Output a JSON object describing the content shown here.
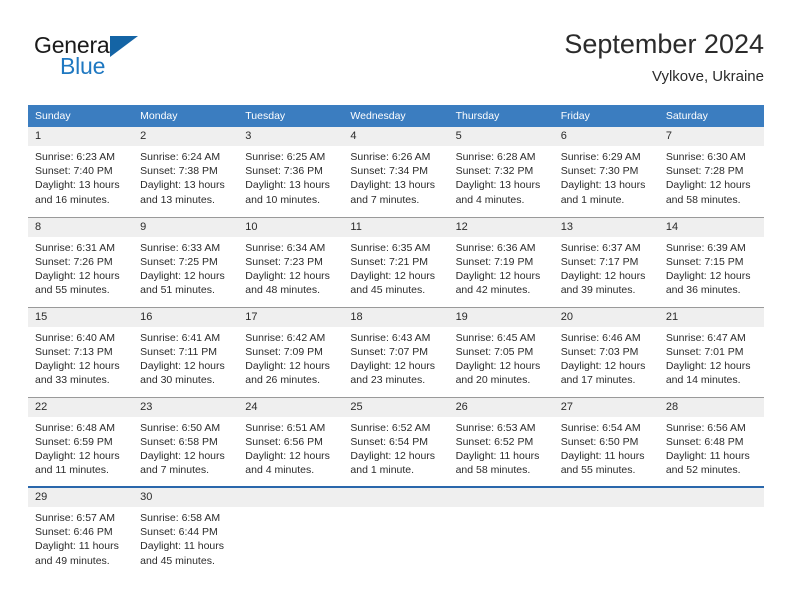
{
  "logo": {
    "word_top": "General",
    "word_bottom": "Blue",
    "accent_color": "#1464a5",
    "blue_text_color": "#1f78c1",
    "triangle_icon": "triangle-icon"
  },
  "header": {
    "title": "September 2024",
    "location": "Vylkove, Ukraine"
  },
  "calendar": {
    "header_bg": "#3b7dc0",
    "daynum_bg": "#efefef",
    "weekdays": [
      "Sunday",
      "Monday",
      "Tuesday",
      "Wednesday",
      "Thursday",
      "Friday",
      "Saturday"
    ],
    "weeks": [
      [
        {
          "day": "1",
          "sunrise": "Sunrise: 6:23 AM",
          "sunset": "Sunset: 7:40 PM",
          "daylight_1": "Daylight: 13 hours",
          "daylight_2": "and 16 minutes."
        },
        {
          "day": "2",
          "sunrise": "Sunrise: 6:24 AM",
          "sunset": "Sunset: 7:38 PM",
          "daylight_1": "Daylight: 13 hours",
          "daylight_2": "and 13 minutes."
        },
        {
          "day": "3",
          "sunrise": "Sunrise: 6:25 AM",
          "sunset": "Sunset: 7:36 PM",
          "daylight_1": "Daylight: 13 hours",
          "daylight_2": "and 10 minutes."
        },
        {
          "day": "4",
          "sunrise": "Sunrise: 6:26 AM",
          "sunset": "Sunset: 7:34 PM",
          "daylight_1": "Daylight: 13 hours",
          "daylight_2": "and 7 minutes."
        },
        {
          "day": "5",
          "sunrise": "Sunrise: 6:28 AM",
          "sunset": "Sunset: 7:32 PM",
          "daylight_1": "Daylight: 13 hours",
          "daylight_2": "and 4 minutes."
        },
        {
          "day": "6",
          "sunrise": "Sunrise: 6:29 AM",
          "sunset": "Sunset: 7:30 PM",
          "daylight_1": "Daylight: 13 hours",
          "daylight_2": "and 1 minute."
        },
        {
          "day": "7",
          "sunrise": "Sunrise: 6:30 AM",
          "sunset": "Sunset: 7:28 PM",
          "daylight_1": "Daylight: 12 hours",
          "daylight_2": "and 58 minutes."
        }
      ],
      [
        {
          "day": "8",
          "sunrise": "Sunrise: 6:31 AM",
          "sunset": "Sunset: 7:26 PM",
          "daylight_1": "Daylight: 12 hours",
          "daylight_2": "and 55 minutes."
        },
        {
          "day": "9",
          "sunrise": "Sunrise: 6:33 AM",
          "sunset": "Sunset: 7:25 PM",
          "daylight_1": "Daylight: 12 hours",
          "daylight_2": "and 51 minutes."
        },
        {
          "day": "10",
          "sunrise": "Sunrise: 6:34 AM",
          "sunset": "Sunset: 7:23 PM",
          "daylight_1": "Daylight: 12 hours",
          "daylight_2": "and 48 minutes."
        },
        {
          "day": "11",
          "sunrise": "Sunrise: 6:35 AM",
          "sunset": "Sunset: 7:21 PM",
          "daylight_1": "Daylight: 12 hours",
          "daylight_2": "and 45 minutes."
        },
        {
          "day": "12",
          "sunrise": "Sunrise: 6:36 AM",
          "sunset": "Sunset: 7:19 PM",
          "daylight_1": "Daylight: 12 hours",
          "daylight_2": "and 42 minutes."
        },
        {
          "day": "13",
          "sunrise": "Sunrise: 6:37 AM",
          "sunset": "Sunset: 7:17 PM",
          "daylight_1": "Daylight: 12 hours",
          "daylight_2": "and 39 minutes."
        },
        {
          "day": "14",
          "sunrise": "Sunrise: 6:39 AM",
          "sunset": "Sunset: 7:15 PM",
          "daylight_1": "Daylight: 12 hours",
          "daylight_2": "and 36 minutes."
        }
      ],
      [
        {
          "day": "15",
          "sunrise": "Sunrise: 6:40 AM",
          "sunset": "Sunset: 7:13 PM",
          "daylight_1": "Daylight: 12 hours",
          "daylight_2": "and 33 minutes."
        },
        {
          "day": "16",
          "sunrise": "Sunrise: 6:41 AM",
          "sunset": "Sunset: 7:11 PM",
          "daylight_1": "Daylight: 12 hours",
          "daylight_2": "and 30 minutes."
        },
        {
          "day": "17",
          "sunrise": "Sunrise: 6:42 AM",
          "sunset": "Sunset: 7:09 PM",
          "daylight_1": "Daylight: 12 hours",
          "daylight_2": "and 26 minutes."
        },
        {
          "day": "18",
          "sunrise": "Sunrise: 6:43 AM",
          "sunset": "Sunset: 7:07 PM",
          "daylight_1": "Daylight: 12 hours",
          "daylight_2": "and 23 minutes."
        },
        {
          "day": "19",
          "sunrise": "Sunrise: 6:45 AM",
          "sunset": "Sunset: 7:05 PM",
          "daylight_1": "Daylight: 12 hours",
          "daylight_2": "and 20 minutes."
        },
        {
          "day": "20",
          "sunrise": "Sunrise: 6:46 AM",
          "sunset": "Sunset: 7:03 PM",
          "daylight_1": "Daylight: 12 hours",
          "daylight_2": "and 17 minutes."
        },
        {
          "day": "21",
          "sunrise": "Sunrise: 6:47 AM",
          "sunset": "Sunset: 7:01 PM",
          "daylight_1": "Daylight: 12 hours",
          "daylight_2": "and 14 minutes."
        }
      ],
      [
        {
          "day": "22",
          "sunrise": "Sunrise: 6:48 AM",
          "sunset": "Sunset: 6:59 PM",
          "daylight_1": "Daylight: 12 hours",
          "daylight_2": "and 11 minutes."
        },
        {
          "day": "23",
          "sunrise": "Sunrise: 6:50 AM",
          "sunset": "Sunset: 6:58 PM",
          "daylight_1": "Daylight: 12 hours",
          "daylight_2": "and 7 minutes."
        },
        {
          "day": "24",
          "sunrise": "Sunrise: 6:51 AM",
          "sunset": "Sunset: 6:56 PM",
          "daylight_1": "Daylight: 12 hours",
          "daylight_2": "and 4 minutes."
        },
        {
          "day": "25",
          "sunrise": "Sunrise: 6:52 AM",
          "sunset": "Sunset: 6:54 PM",
          "daylight_1": "Daylight: 12 hours",
          "daylight_2": "and 1 minute."
        },
        {
          "day": "26",
          "sunrise": "Sunrise: 6:53 AM",
          "sunset": "Sunset: 6:52 PM",
          "daylight_1": "Daylight: 11 hours",
          "daylight_2": "and 58 minutes."
        },
        {
          "day": "27",
          "sunrise": "Sunrise: 6:54 AM",
          "sunset": "Sunset: 6:50 PM",
          "daylight_1": "Daylight: 11 hours",
          "daylight_2": "and 55 minutes."
        },
        {
          "day": "28",
          "sunrise": "Sunrise: 6:56 AM",
          "sunset": "Sunset: 6:48 PM",
          "daylight_1": "Daylight: 11 hours",
          "daylight_2": "and 52 minutes."
        }
      ],
      [
        {
          "day": "29",
          "sunrise": "Sunrise: 6:57 AM",
          "sunset": "Sunset: 6:46 PM",
          "daylight_1": "Daylight: 11 hours",
          "daylight_2": "and 49 minutes."
        },
        {
          "day": "30",
          "sunrise": "Sunrise: 6:58 AM",
          "sunset": "Sunset: 6:44 PM",
          "daylight_1": "Daylight: 11 hours",
          "daylight_2": "and 45 minutes."
        },
        {
          "day": "",
          "sunrise": "",
          "sunset": "",
          "daylight_1": "",
          "daylight_2": ""
        },
        {
          "day": "",
          "sunrise": "",
          "sunset": "",
          "daylight_1": "",
          "daylight_2": ""
        },
        {
          "day": "",
          "sunrise": "",
          "sunset": "",
          "daylight_1": "",
          "daylight_2": ""
        },
        {
          "day": "",
          "sunrise": "",
          "sunset": "",
          "daylight_1": "",
          "daylight_2": ""
        },
        {
          "day": "",
          "sunrise": "",
          "sunset": "",
          "daylight_1": "",
          "daylight_2": ""
        }
      ]
    ]
  }
}
